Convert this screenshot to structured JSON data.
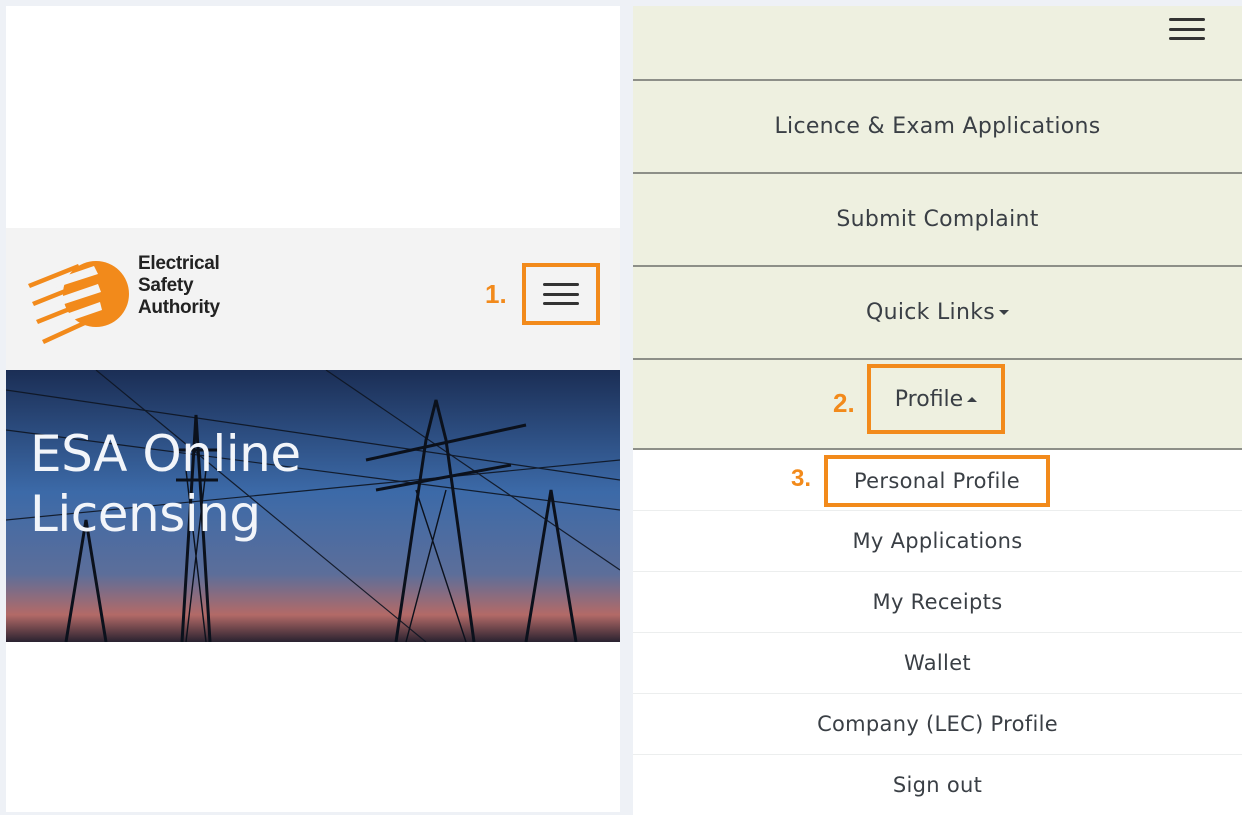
{
  "left": {
    "logo": {
      "line1": "Electrical",
      "line2": "Safety",
      "line3": "Authority"
    },
    "step1": "1.",
    "hero_title_line1": "ESA Online",
    "hero_title_line2": "Licensing"
  },
  "right": {
    "nav": [
      {
        "label": "Licence & Exam Applications"
      },
      {
        "label": "Submit Complaint"
      },
      {
        "label": "Quick Links"
      },
      {
        "label": "Profile"
      }
    ],
    "step2": "2.",
    "step3": "3.",
    "profile_menu": [
      {
        "label": "Personal Profile"
      },
      {
        "label": "My Applications"
      },
      {
        "label": "My Receipts"
      },
      {
        "label": "Wallet"
      },
      {
        "label": "Company (LEC) Profile"
      },
      {
        "label": "Sign out"
      }
    ]
  },
  "colors": {
    "accent": "#f28a1b",
    "nav_bg": "#eef0e0",
    "text": "#3a3f45"
  }
}
